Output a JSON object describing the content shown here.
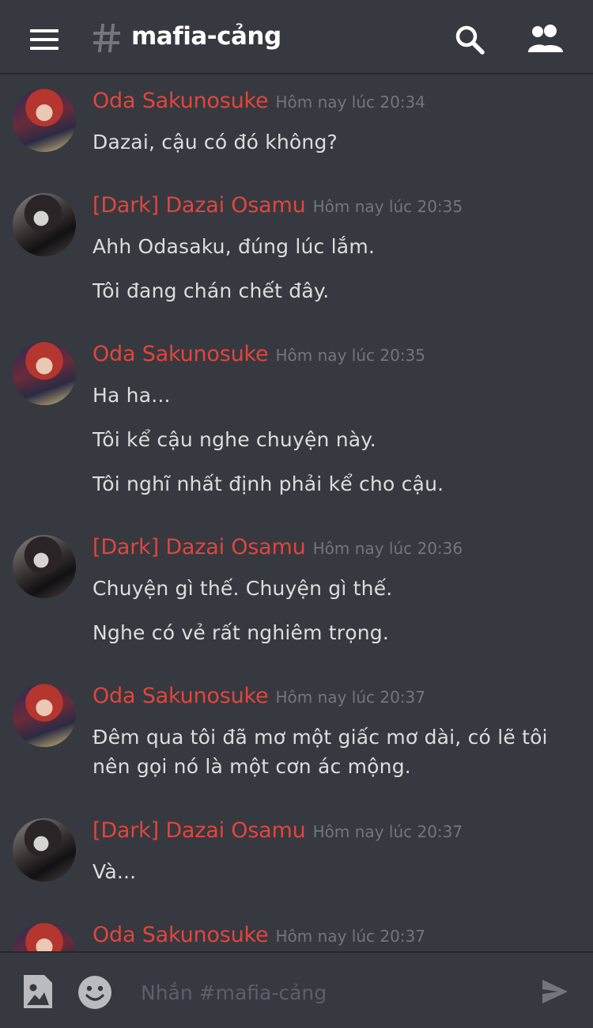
{
  "header": {
    "channel_name": "mafia-cảng"
  },
  "messages": [
    {
      "author": "Oda Sakunosuke",
      "timestamp": "Hôm nay lúc 20:34",
      "lines": [
        "Dazai, cậu có đó không?"
      ]
    },
    {
      "author": "[Dark] Dazai Osamu",
      "timestamp": "Hôm nay lúc 20:35",
      "lines": [
        "Ahh Odasaku, đúng lúc lắm.",
        "Tôi đang chán chết đây."
      ]
    },
    {
      "author": "Oda Sakunosuke",
      "timestamp": "Hôm nay lúc 20:35",
      "lines": [
        "Ha ha...",
        "Tôi kể cậu nghe chuyện này.",
        "Tôi nghĩ nhất định phải kể cho cậu."
      ]
    },
    {
      "author": "[Dark] Dazai Osamu",
      "timestamp": "Hôm nay lúc 20:36",
      "lines": [
        "Chuyện gì thế. Chuyện gì thế.",
        "Nghe có vẻ rất nghiêm trọng."
      ]
    },
    {
      "author": "Oda Sakunosuke",
      "timestamp": "Hôm nay lúc 20:37",
      "lines": [
        "Đêm qua tôi đã mơ một giấc mơ dài, có lẽ tôi",
        "nên gọi nó là một cơn ác mộng."
      ]
    },
    {
      "author": "[Dark] Dazai Osamu",
      "timestamp": "Hôm nay lúc 20:37",
      "lines": [
        "Và..."
      ]
    },
    {
      "author": "Oda Sakunosuke",
      "timestamp": "Hôm nay lúc 20:37",
      "lines": []
    }
  ],
  "composer": {
    "placeholder": "Nhắn #mafia-cảng"
  },
  "colors": {
    "background": "#36393f",
    "author": "#e2453c",
    "timestamp": "#72767d",
    "text": "#dcddde"
  }
}
